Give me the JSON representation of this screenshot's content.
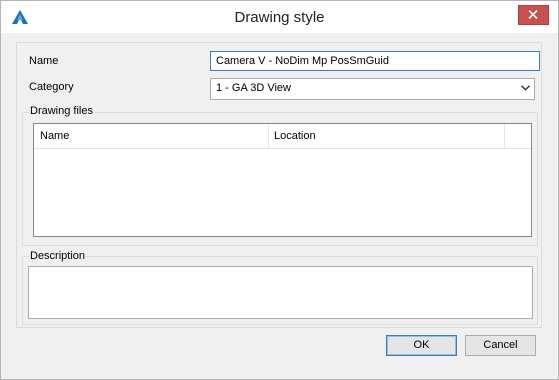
{
  "window": {
    "title": "Drawing style",
    "icon": "app-logo-icon",
    "close_icon": "close-icon",
    "accent_close": "#c75050"
  },
  "form": {
    "name_label": "Name",
    "name_value": "Camera V - NoDim Mp PosSmGuid",
    "category_label": "Category",
    "category_value": "1 - GA 3D View"
  },
  "drawing_files": {
    "group_label": "Drawing files",
    "columns": [
      "Name",
      "Location"
    ]
  },
  "description": {
    "group_label": "Description",
    "value": ""
  },
  "buttons": {
    "ok": "OK",
    "cancel": "Cancel"
  }
}
